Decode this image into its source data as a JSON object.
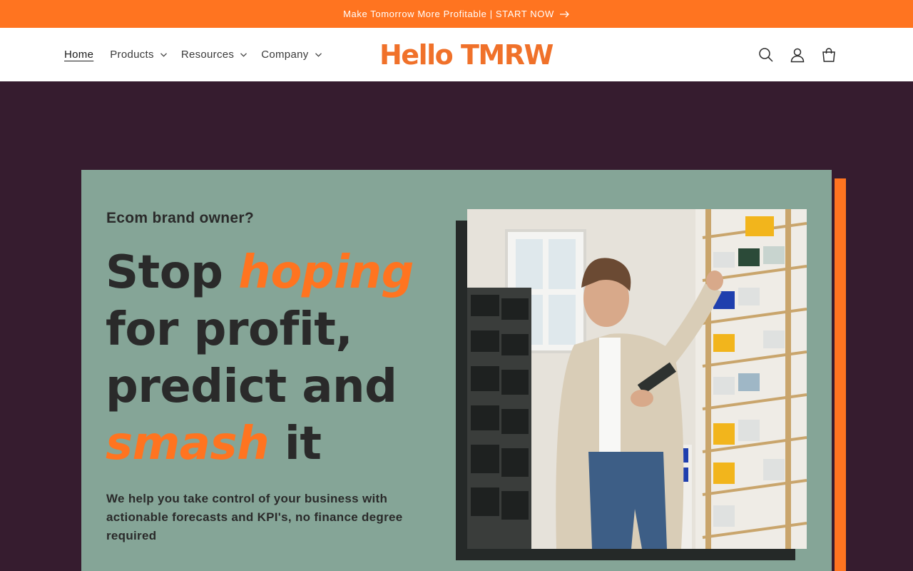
{
  "announcement": {
    "text": "Make Tomorrow More Profitable | START NOW"
  },
  "nav": {
    "home": "Home",
    "products": "Products",
    "resources": "Resources",
    "company": "Company"
  },
  "logo": {
    "text": "Hello TMRW"
  },
  "header_icons": [
    "search-icon",
    "account-icon",
    "cart-icon"
  ],
  "hero": {
    "eyebrow": "Ecom brand owner?",
    "headline": {
      "stop": "Stop",
      "hoping": "hoping",
      "for_profit": "for profit,",
      "predict_and": "predict and",
      "smash": "smash",
      "it": "it"
    },
    "subtext": "We help you take control of your business with actionable forecasts and KPI's, no finance degree required"
  },
  "colors": {
    "brand_orange": "#ff7420",
    "dark_plum": "#361c2f",
    "sage": "#85a597",
    "text_dark": "#2a2a2a"
  }
}
